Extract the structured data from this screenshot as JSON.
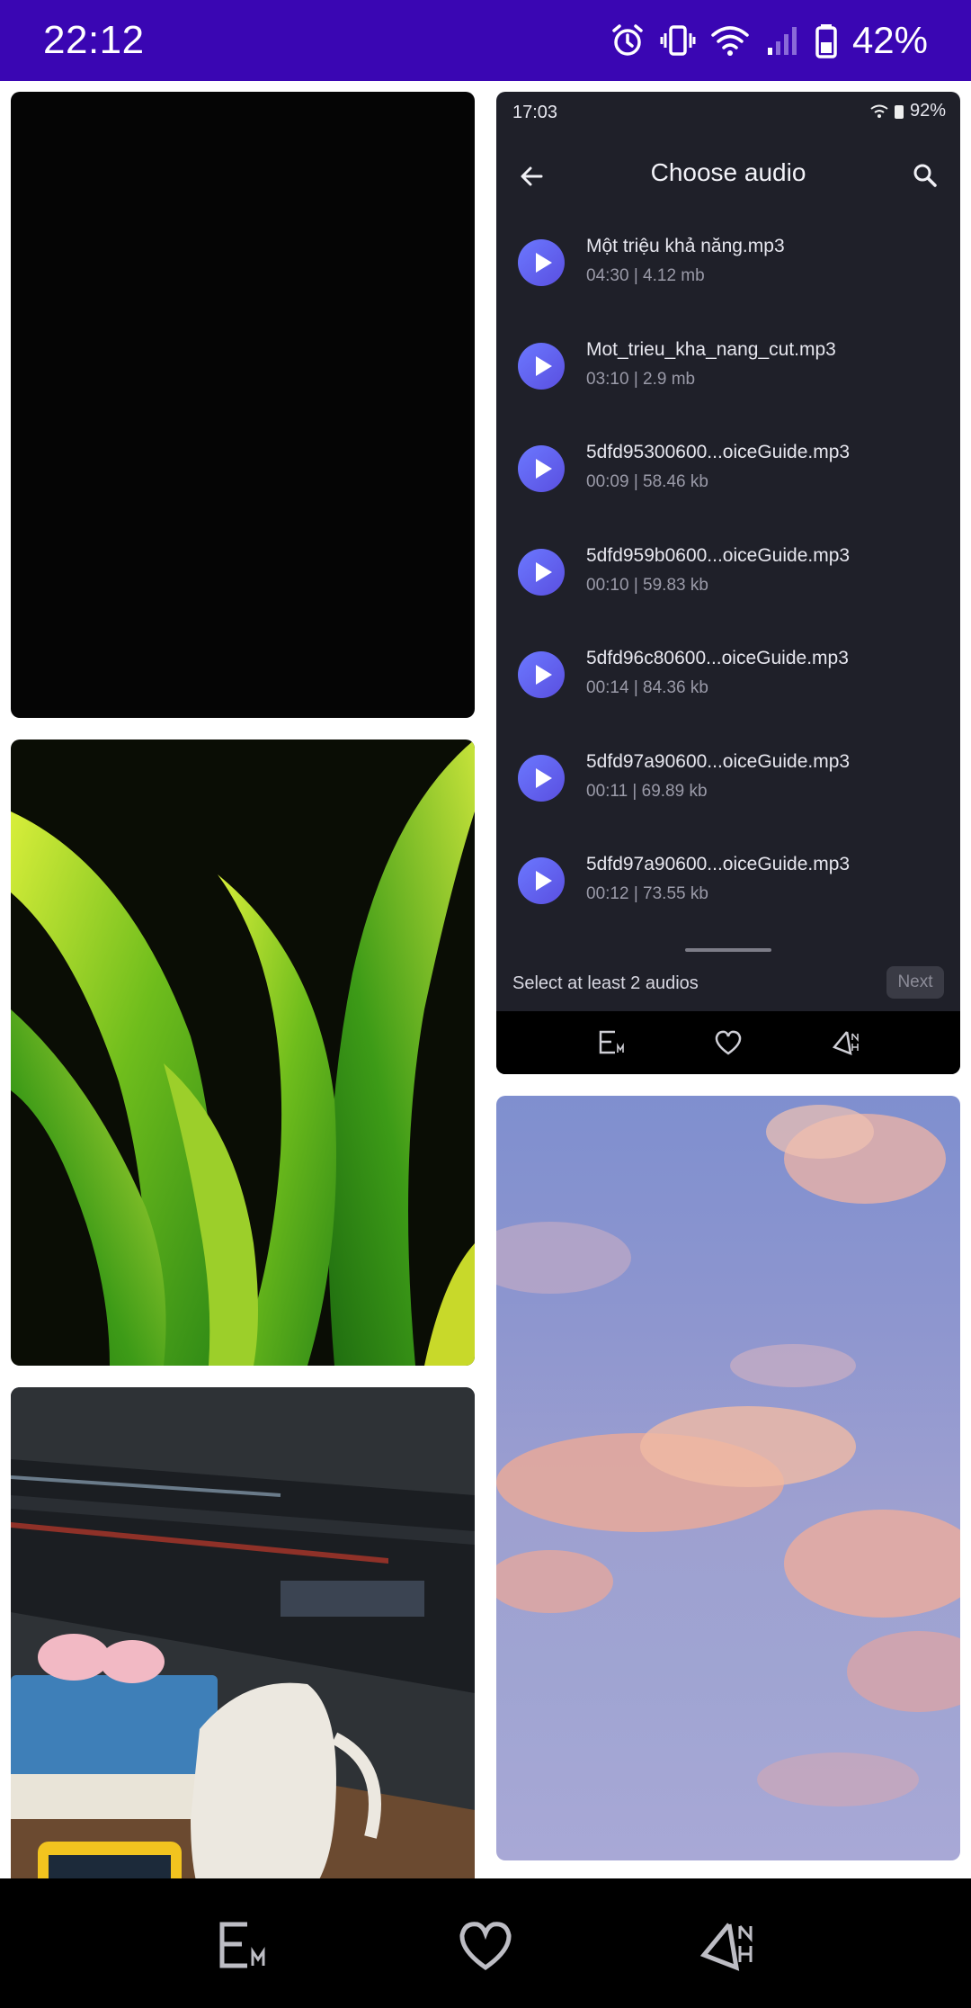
{
  "status_bar": {
    "time": "22:12",
    "battery_percent": "42%",
    "icons": [
      "alarm-icon",
      "vibrate-icon",
      "wifi-icon",
      "signal-icon",
      "battery-icon"
    ]
  },
  "gallery": {
    "left_column": [
      {
        "name": "dark-photo"
      },
      {
        "name": "snake-plant-photo"
      },
      {
        "name": "desk-computer-photo"
      }
    ],
    "right_column": [
      {
        "name": "choose-audio-screenshot"
      },
      {
        "name": "sky-clouds-photo"
      }
    ]
  },
  "screenshot": {
    "status": {
      "time": "17:03",
      "battery": "92%"
    },
    "title": "Choose audio",
    "audios": [
      {
        "name": "Một triệu khả năng.mp3",
        "meta": "04:30 | 4.12 mb"
      },
      {
        "name": "Mot_trieu_kha_nang_cut.mp3",
        "meta": "03:10 | 2.9 mb"
      },
      {
        "name": "5dfd95300600...oiceGuide.mp3",
        "meta": "00:09 | 58.46 kb"
      },
      {
        "name": "5dfd959b0600...oiceGuide.mp3",
        "meta": "00:10 | 59.83 kb"
      },
      {
        "name": "5dfd96c80600...oiceGuide.mp3",
        "meta": "00:14 | 84.36 kb"
      },
      {
        "name": "5dfd97a90600...oiceGuide.mp3",
        "meta": "00:11 | 69.89 kb"
      },
      {
        "name": "5dfd97a90600...oiceGuide.mp3",
        "meta": "00:12 | 73.55 kb"
      }
    ],
    "hint": "Select at least 2 audios",
    "next_label": "Next"
  },
  "bottom_nav": {
    "items": [
      {
        "name": "em-tab",
        "icon": "em-logo-icon"
      },
      {
        "name": "heart-tab",
        "icon": "heart-icon"
      },
      {
        "name": "anh-tab",
        "icon": "anh-logo-icon"
      }
    ]
  },
  "colors": {
    "status_bar": "#3a06b3",
    "app_background": "#1f2029",
    "play_button": "#5f63f0",
    "nav_background": "#000000"
  }
}
